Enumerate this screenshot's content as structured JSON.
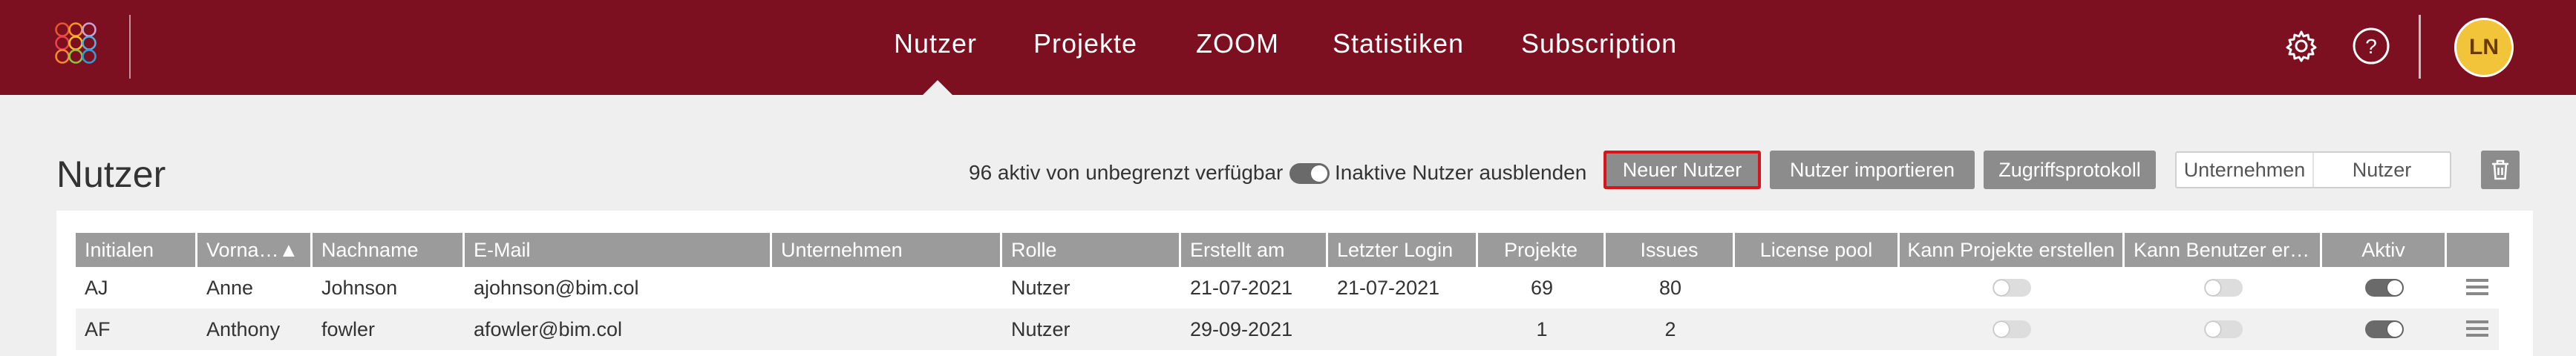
{
  "nav": {
    "items": [
      {
        "label": "Nutzer"
      },
      {
        "label": "Projekte"
      },
      {
        "label": "ZOOM"
      },
      {
        "label": "Statistiken"
      },
      {
        "label": "Subscription"
      }
    ],
    "active": "Nutzer",
    "avatar_initials": "LN",
    "settings_icon": "gear-icon",
    "help_icon": "help-circle-icon"
  },
  "header": {
    "title": "Nutzer",
    "active_info": "96 aktiv von unbegrenzt verfügbar",
    "hide_inactive_label": "Inaktive Nutzer ausblenden",
    "hide_inactive_on": true,
    "buttons": {
      "new_user": "Neuer Nutzer",
      "import_users": "Nutzer importieren",
      "access_log": "Zugriffsprotokoll"
    },
    "segment": {
      "company": "Unternehmen",
      "user": "Nutzer"
    },
    "trash_icon": "trash-icon"
  },
  "table": {
    "columns": [
      "Initialen",
      "Vorna…▲",
      "Nachname",
      "E-Mail",
      "Unternehmen",
      "Rolle",
      "Erstellt am",
      "Letzter Login",
      "Projekte",
      "Issues",
      "License pool",
      "Kann Projekte erstellen",
      "Kann Benutzer er…",
      "Aktiv",
      ""
    ],
    "rows": [
      {
        "initials": "AJ",
        "first": "Anne",
        "last": "Johnson",
        "email": "ajohnson@bim.col",
        "company": "",
        "role": "Nutzer",
        "created": "21-07-2021",
        "last_login": "21-07-2021",
        "projects": "69",
        "issues": "80",
        "license_pool": "",
        "can_create_projects": false,
        "can_create_users": false,
        "active": true
      },
      {
        "initials": "AF",
        "first": "Anthony",
        "last": "fowler",
        "email": "afowler@bim.col",
        "company": "",
        "role": "Nutzer",
        "created": "29-09-2021",
        "last_login": "",
        "projects": "1",
        "issues": "2",
        "license_pool": "",
        "can_create_projects": false,
        "can_create_users": false,
        "active": true
      }
    ]
  },
  "colors": {
    "topbar": "#7d1020",
    "avatar": "#f2c43a",
    "highlight": "#d9141c",
    "button": "#8c8c8c"
  }
}
